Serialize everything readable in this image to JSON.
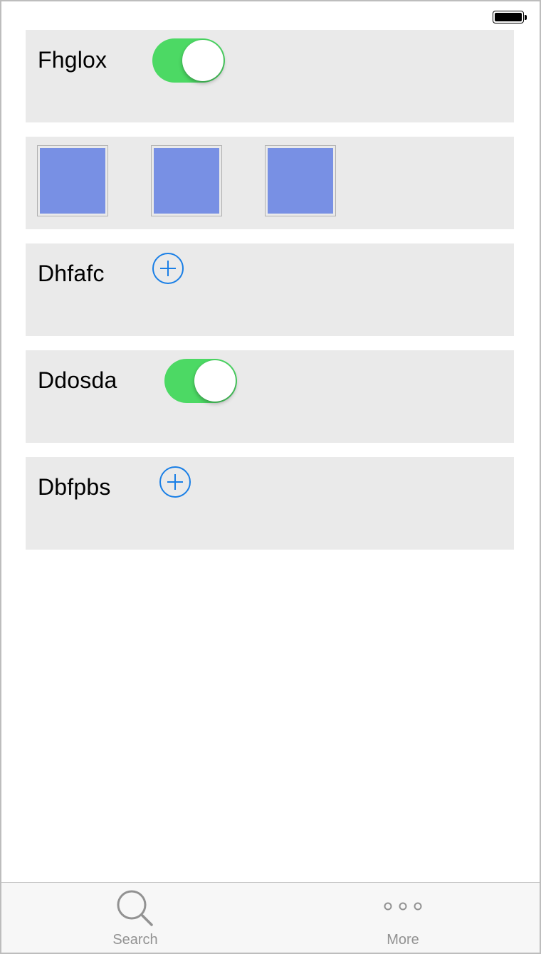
{
  "status_bar": {
    "battery_icon": "battery-icon"
  },
  "rows": {
    "row1": {
      "label": "Fhglox",
      "toggle_on": true
    },
    "swatches": {
      "colors": [
        "#7890e4",
        "#7890e4",
        "#7890e4"
      ]
    },
    "row3": {
      "label": "Dhfafc",
      "icon": "add-circle-icon"
    },
    "row4": {
      "label": "Ddosda",
      "toggle_on": true
    },
    "row5": {
      "label": "Dbfpbs",
      "icon": "add-circle-icon"
    }
  },
  "tabbar": {
    "tabs": [
      {
        "label": "Search",
        "icon": "search-icon"
      },
      {
        "label": "More",
        "icon": "more-icon"
      }
    ]
  },
  "colors": {
    "toggle_on": "#4cd964",
    "accent_blue": "#1a7fe6",
    "card_background": "#eaeaea",
    "swatch": "#7890e4"
  }
}
